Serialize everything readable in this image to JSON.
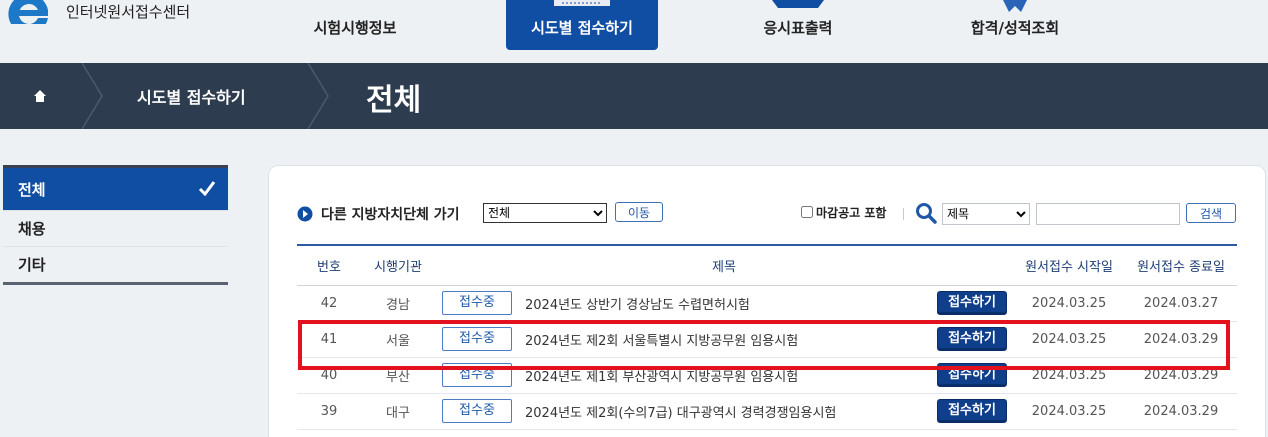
{
  "logo": {
    "text": "인터넷원서접수센터",
    "color": "#1e78c8"
  },
  "nav": [
    {
      "label": "시험시행정보",
      "active": false
    },
    {
      "label": "시도별 접수하기",
      "active": true
    },
    {
      "label": "응시표출력",
      "active": false
    },
    {
      "label": "합격/성적조회",
      "active": false
    }
  ],
  "breadcrumb": {
    "home_icon": "home-icon",
    "section": "시도별 접수하기",
    "current": "전체"
  },
  "sidebar": {
    "items": [
      {
        "label": "전체",
        "active": true
      },
      {
        "label": "채용",
        "active": false
      },
      {
        "label": "기타",
        "active": false
      }
    ]
  },
  "filter": {
    "label": "다른 지방자치단체 가기",
    "region_selected": "전체",
    "move_label": "이동",
    "include_closed_label": "마감공고 포함",
    "include_closed_checked": false,
    "search_field_selected": "제목",
    "search_value": "",
    "search_label": "검색"
  },
  "table": {
    "headers": [
      "번호",
      "시행기관",
      "제목",
      "원서접수 시작일",
      "원서접수 종료일"
    ],
    "rows": [
      {
        "no": "42",
        "org": "경남",
        "status": "접수중",
        "title": "2024년도 상반기 경상남도 수렵면허시험",
        "apply": "접수하기",
        "start": "2024.03.25",
        "end": "2024.03.27"
      },
      {
        "no": "41",
        "org": "서울",
        "status": "접수중",
        "title": "2024년도 제2회 서울특별시 지방공무원 임용시험",
        "apply": "접수하기",
        "start": "2024.03.25",
        "end": "2024.03.29"
      },
      {
        "no": "40",
        "org": "부산",
        "status": "접수중",
        "title": "2024년도 제1회 부산광역시 지방공무원 임용시험",
        "apply": "접수하기",
        "start": "2024.03.25",
        "end": "2024.03.29"
      },
      {
        "no": "39",
        "org": "대구",
        "status": "접수중",
        "title": "2024년도 제2회(수의7급) 대구광역시 경력경쟁임용시험",
        "apply": "접수하기",
        "start": "2024.03.25",
        "end": "2024.03.29"
      }
    ]
  },
  "colors": {
    "primary": "#0f4ea3",
    "band": "#2e3c50",
    "highlight": "#e3101d"
  }
}
